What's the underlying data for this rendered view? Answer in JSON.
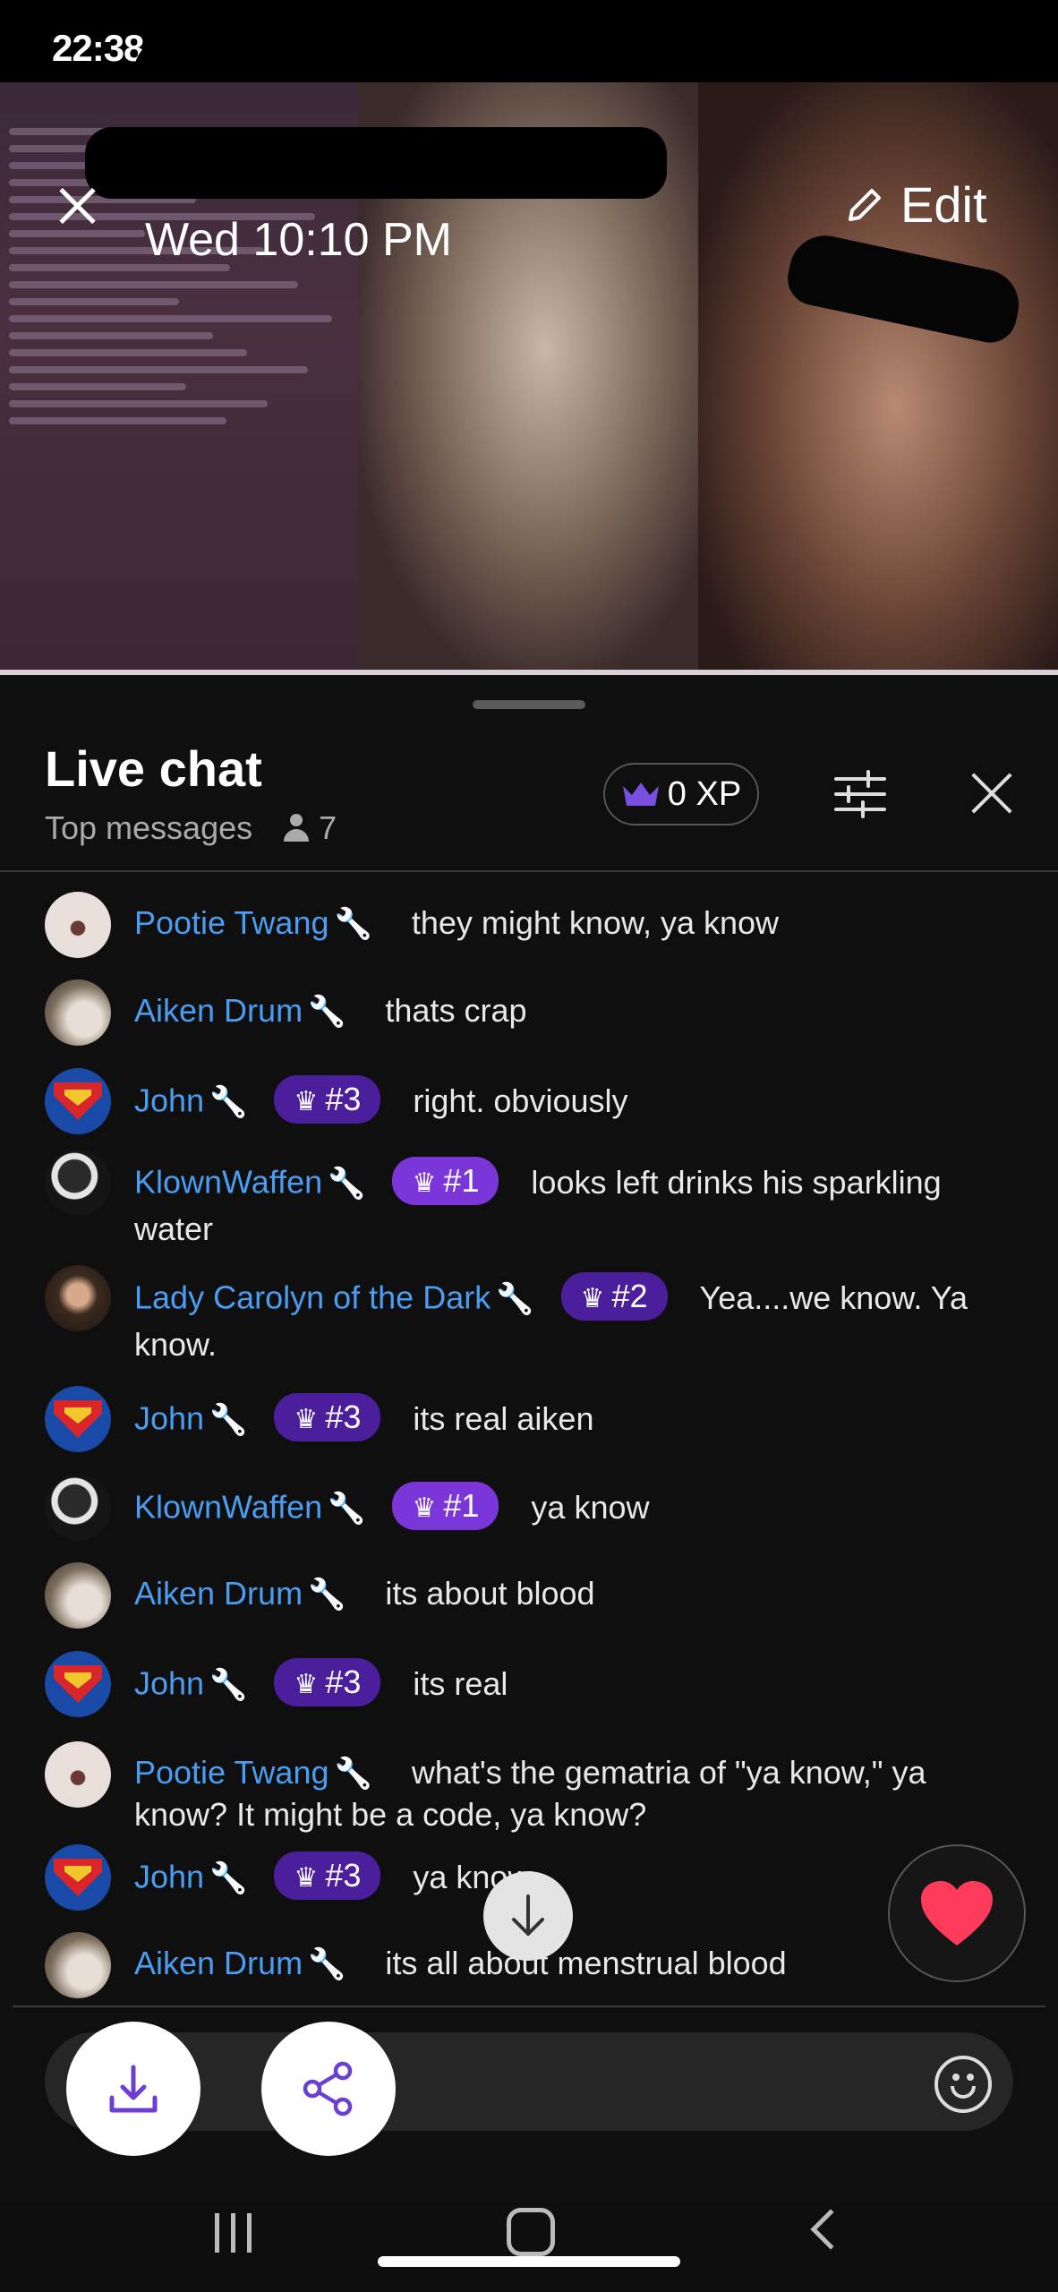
{
  "status_bar": {
    "time": "22:38"
  },
  "video": {
    "date": "Wed 10:10 PM",
    "edit_label": "Edit"
  },
  "chat": {
    "title": "Live chat",
    "mode": "Top messages",
    "viewer_count": "7",
    "xp": "0 XP",
    "messages": [
      {
        "author": "Pootie Twang",
        "badge": "",
        "text": "they might know, ya know",
        "avatar": "pootie"
      },
      {
        "author": "Aiken Drum",
        "badge": "",
        "text": "thats crap",
        "avatar": "aiken"
      },
      {
        "author": "John",
        "badge": "#3",
        "text": "right. obviously",
        "avatar": "john"
      },
      {
        "author": "KlownWaffen",
        "badge": "#1",
        "text": "looks left drinks his sparkling water",
        "avatar": "klown"
      },
      {
        "author": "Lady Carolyn of the Dark",
        "badge": "#2",
        "text": "Yea....we know. Ya know.",
        "avatar": "lady"
      },
      {
        "author": "John",
        "badge": "#3",
        "text": "its real aiken",
        "avatar": "john"
      },
      {
        "author": "KlownWaffen",
        "badge": "#1",
        "text": "ya know",
        "avatar": "klown"
      },
      {
        "author": "Aiken Drum",
        "badge": "",
        "text": "its about blood",
        "avatar": "aiken"
      },
      {
        "author": "John",
        "badge": "#3",
        "text": "its real",
        "avatar": "john"
      },
      {
        "author": "Pootie Twang",
        "badge": "",
        "text": "what's the gematria of \"ya know,\" ya know? It might be a code, ya know?",
        "avatar": "pootie"
      },
      {
        "author": "John",
        "badge": "#3",
        "text": "ya know",
        "avatar": "john"
      },
      {
        "author": "Aiken Drum",
        "badge": "",
        "text": "its all about menstrual blood",
        "avatar": "aiken"
      }
    ]
  },
  "icons": {
    "moderator": "wrench-icon",
    "badge": "crown-icon"
  },
  "colors": {
    "author": "#4a9df0",
    "badge_top1": "#7a36d8",
    "badge": "#4b1e9b",
    "accent_action": "#6b3fd6"
  }
}
